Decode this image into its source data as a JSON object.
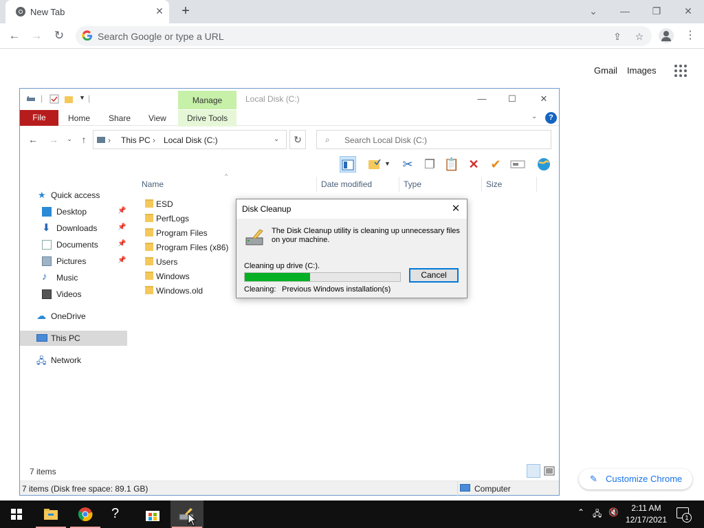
{
  "chrome": {
    "tab_title": "New Tab",
    "tab_close": "✕",
    "new_tab": "+",
    "omnibox_placeholder": "Search Google or type a URL",
    "links": [
      "Gmail",
      "Images"
    ],
    "customize_label": "Customize Chrome",
    "accent": "#1a73e8"
  },
  "explorer": {
    "manage_tab": "Manage",
    "drive_tools_tab": "Drive Tools",
    "window_title": "Local Disk (C:)",
    "ribbon_tabs": {
      "file": "File",
      "home": "Home",
      "share": "Share",
      "view": "View"
    },
    "file_tab_color": "#b71c1c",
    "breadcrumb": [
      "This PC",
      "Local Disk (C:)"
    ],
    "breadcrumb_sep": "›",
    "search_placeholder": "Search Local Disk (C:)",
    "columns": {
      "name": "Name",
      "date": "Date modified",
      "type": "Type",
      "size": "Size"
    },
    "nav": {
      "quick_access": "Quick access",
      "desktop": "Desktop",
      "downloads": "Downloads",
      "documents": "Documents",
      "pictures": "Pictures",
      "music": "Music",
      "videos": "Videos",
      "onedrive": "OneDrive",
      "this_pc": "This PC",
      "network": "Network"
    },
    "files": [
      "ESD",
      "PerfLogs",
      "Program Files",
      "Program Files (x86)",
      "Users",
      "Windows",
      "Windows.old"
    ],
    "items_count": "7 items",
    "status_left": "7 items (Disk free space: 89.1 GB)",
    "status_right": "Computer"
  },
  "disk_cleanup": {
    "title": "Disk Cleanup",
    "message": "The Disk Cleanup utility is cleaning up unnecessary files on your machine.",
    "status": "Cleaning up drive  (C:).",
    "progress": 0.42,
    "progress_color": "#06b025",
    "cancel_label": "Cancel",
    "cleaning_label": "Cleaning:",
    "cleaning_value": "Previous Windows installation(s)"
  },
  "taskbar": {
    "time": "2:11 AM",
    "date": "12/17/2021",
    "notification_count": "1"
  }
}
